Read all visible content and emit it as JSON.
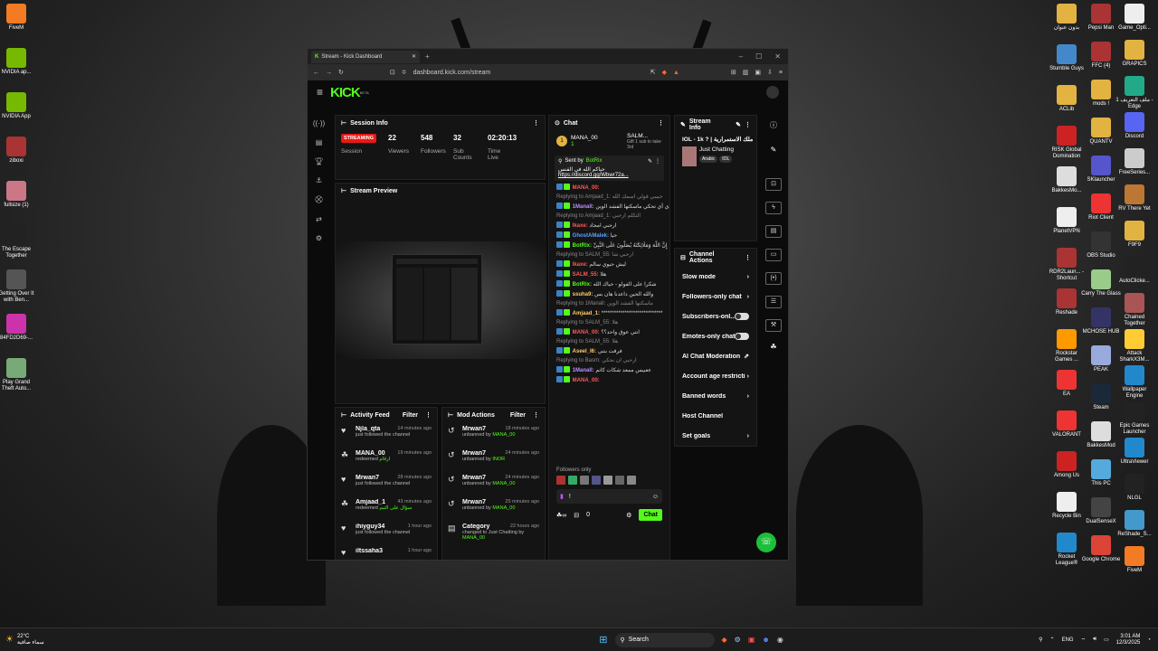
{
  "desktop_left": [
    {
      "label": "FiveM",
      "color": "#f27b23"
    },
    {
      "label": "NVIDIA ap...",
      "color": "#76b900"
    },
    {
      "label": "NVIDIA App",
      "color": "#76b900"
    },
    {
      "label": "ziboxi",
      "color": "#a33"
    },
    {
      "label": "fullsize (1)",
      "color": "#c78"
    },
    {
      "label": "The Escape Together",
      "color": "#222"
    },
    {
      "label": "Getting Over It with Ben...",
      "color": "#555"
    },
    {
      "label": "84FD2D69-...",
      "color": "#c3a"
    },
    {
      "label": "Play Grand Theft Auto...",
      "color": "#7a7"
    }
  ],
  "desktop_right_a": [
    {
      "label": "بدون عنوان",
      "color": "#e3b341"
    },
    {
      "label": "Stumble Guys",
      "color": "#48c"
    },
    {
      "label": "ACLib",
      "color": "#e3b341"
    },
    {
      "label": "RISK Global Domination",
      "color": "#c22"
    },
    {
      "label": "BakkesMo...",
      "color": "#ddd"
    },
    {
      "label": "PlanetVPN",
      "color": "#eee"
    },
    {
      "label": "RDR2Laun... - Shortcut",
      "color": "#a33"
    },
    {
      "label": "Reshade",
      "color": "#a33"
    },
    {
      "label": "Rockstar Games ...",
      "color": "#f90"
    },
    {
      "label": "EA",
      "color": "#e33"
    },
    {
      "label": "VALORANT",
      "color": "#e33"
    },
    {
      "label": "Among Us",
      "color": "#c22"
    },
    {
      "label": "Recycle Bin",
      "color": "#eee"
    },
    {
      "label": "Rocket League®",
      "color": "#28c"
    }
  ],
  "desktop_right_b": [
    {
      "label": "Pepsi Man",
      "color": "#a33"
    },
    {
      "label": "FFC (4)",
      "color": "#a33"
    },
    {
      "label": "mods !",
      "color": "#e3b341"
    },
    {
      "label": "QUANTV",
      "color": "#e3b341"
    },
    {
      "label": "SKlauncher",
      "color": "#55c"
    },
    {
      "label": "Riot Client",
      "color": "#e33"
    },
    {
      "label": "OBS Studio",
      "color": "#333"
    },
    {
      "label": "Carry The Glass",
      "color": "#9c8"
    },
    {
      "label": "MCHOSE HUB",
      "color": "#336"
    },
    {
      "label": "PEAK",
      "color": "#9ad"
    },
    {
      "label": "Steam",
      "color": "#1b2838"
    },
    {
      "label": "BakkesMod",
      "color": "#ddd"
    },
    {
      "label": "This PC",
      "color": "#5ad"
    },
    {
      "label": "DualSenseX",
      "color": "#444"
    },
    {
      "label": "Google Chrome",
      "color": "#db4437"
    }
  ],
  "desktop_right_c": [
    {
      "label": "Game_Opti...",
      "color": "#eee"
    },
    {
      "label": "GRAPICS",
      "color": "#e3b341"
    },
    {
      "label": "ملف التعريف 1 - Edge",
      "color": "#2a8"
    },
    {
      "label": "Discord",
      "color": "#5865f2"
    },
    {
      "label": "FreeSeries...",
      "color": "#ccc"
    },
    {
      "label": "RV There Yet",
      "color": "#b73"
    },
    {
      "label": "F9F9",
      "color": "#e3b341"
    },
    {
      "label": "AutoClicke...",
      "color": "#222"
    },
    {
      "label": "Chained Together",
      "color": "#a55"
    },
    {
      "label": "Attack SharkX3M...",
      "color": "#fc3"
    },
    {
      "label": "Wallpaper Engine",
      "color": "#28c"
    },
    {
      "label": "Epic Games Launcher",
      "color": "#222"
    },
    {
      "label": "UltraViewer",
      "color": "#28c"
    },
    {
      "label": "NLGL",
      "color": "#222"
    },
    {
      "label": "ReShade_S...",
      "color": "#49c"
    },
    {
      "label": "FiveM",
      "color": "#f27b23"
    }
  ],
  "browser": {
    "tab_title": "Stream - Kick Dashboard",
    "url": "dashboard.kick.com/stream"
  },
  "kick": {
    "logo": "KICK",
    "logo_sup": "BETA"
  },
  "session": {
    "title": "Session Info",
    "status": "STREAMING",
    "status_label": "Session",
    "viewers": "22",
    "viewers_label": "Viewers",
    "followers": "548",
    "followers_label": "Followers",
    "subs": "32",
    "subs_label": "Sub Counts",
    "time": "02:20:13",
    "time_label": "Time Live"
  },
  "preview": {
    "title": "Stream Preview"
  },
  "activity": {
    "title": "Activity Feed",
    "filter": "Filter",
    "items": [
      {
        "icon": "♥",
        "name": "Njla_qta",
        "time": "14 minutes ago",
        "desc": "just followed the channel",
        "extra": ""
      },
      {
        "icon": "☘",
        "name": "MANA_00",
        "time": "19 minutes ago",
        "desc": "redeemed",
        "extra": "ارقام"
      },
      {
        "icon": "♥",
        "name": "Mrwan7",
        "time": "28 minutes ago",
        "desc": "just followed the channel",
        "extra": ""
      },
      {
        "icon": "☘",
        "name": "Amjaad_1",
        "time": "43 minutes ago",
        "desc": "redeemed",
        "extra": "سؤال على التيم"
      },
      {
        "icon": "♥",
        "name": "ihiyguy34",
        "time": "1 hour ago",
        "desc": "just followed the channel",
        "extra": ""
      },
      {
        "icon": "♥",
        "name": "iltssaha3",
        "time": "1 hour ago",
        "desc": "",
        "extra": ""
      }
    ]
  },
  "mod": {
    "title": "Mod Actions",
    "filter": "Filter",
    "items": [
      {
        "name": "Mrwan7",
        "time": "18 minutes ago",
        "desc": "unbanned by",
        "who": "MANA_00"
      },
      {
        "name": "Mrwan7",
        "time": "24 minutes ago",
        "desc": "unbanned by",
        "who": "INOR"
      },
      {
        "name": "Mrwan7",
        "time": "24 minutes ago",
        "desc": "unbanned by",
        "who": "MANA_00"
      },
      {
        "name": "Mrwan7",
        "time": "25 minutes ago",
        "desc": "unbanned by",
        "who": "MANA_00"
      },
      {
        "name": "Category",
        "time": "22 hours ago",
        "desc": "changed to Just Chatting by",
        "who": "MANA_00"
      }
    ]
  },
  "chat": {
    "title": "Chat",
    "top_user": "MANA_00",
    "top_count": "1",
    "gift_user": "SALM...",
    "gift_text": "Gift 1 sub to take 3rd",
    "pinned_sent_by": "Sent by",
    "pinned_bot": "BotRix",
    "pinned_text": "حياكم الله في القنس",
    "pinned_link": "https://discord.gg/Wbwr72a...",
    "lines": [
      {
        "reply": "",
        "user": "MANA_00:",
        "ucolor": "#ff5a5a",
        "text": ""
      },
      {
        "reply": "Replying to Amjaad_1: حبيبي قولي اسمك الله",
        "user": "",
        "ucolor": "",
        "text": ""
      },
      {
        "reply": "",
        "user": "1Manall:",
        "ucolor": "#b890ff",
        "text": "لا ذي أي تحكي ماسكتها الفشد الوين"
      },
      {
        "reply": "Replying to Amjaad_1: التكلم ارحبي",
        "user": "",
        "ucolor": "",
        "text": ""
      },
      {
        "reply": "",
        "user": "lkaxe:",
        "ucolor": "#ff5a5a",
        "text": "ارحبي امجاد"
      },
      {
        "reply": "",
        "user": "GhostAMalek:",
        "ucolor": "#5aa0ff",
        "text": "حيا"
      },
      {
        "reply": "",
        "user": "BotRix:",
        "ucolor": "#53fc18",
        "text": "إِنَّ اللَّهَ وَمَلَائِكَتَهُ يُصَلُّونَ عَلَى النَّبِيِّ"
      },
      {
        "reply": "Replying to SALM_55: ارحبي شا",
        "user": "",
        "ucolor": "",
        "text": ""
      },
      {
        "reply": "",
        "user": "lkaxe:",
        "ucolor": "#ff5a5a",
        "text": "ليش حيوي سالم"
      },
      {
        "reply": "",
        "user": "SALM_55:",
        "ucolor": "#ff5a5a",
        "text": "هلا"
      },
      {
        "reply": "",
        "user": "BotRix:",
        "ucolor": "#53fc18",
        "text": "شكرا على الفولو - حياك الله"
      },
      {
        "reply": "",
        "user": "ssuha9:",
        "ucolor": "#ffcc66",
        "text": "والله الحين داعدنا هان بس"
      },
      {
        "reply": "Replying to 1Manall: ماسكتها الفشد الوين",
        "user": "",
        "ucolor": "",
        "text": ""
      },
      {
        "reply": "",
        "user": "Amjaad_1:",
        "ucolor": "#ffcc66",
        "text": "*****************************"
      },
      {
        "reply": "Replying to SALM_55: هلا",
        "user": "",
        "ucolor": "",
        "text": ""
      },
      {
        "reply": "",
        "user": "MANA_00:",
        "ucolor": "#ff5a5a",
        "text": "انتي عوق واحد؟؟"
      },
      {
        "reply": "Replying to SALM_55: هلا",
        "user": "",
        "ucolor": "",
        "text": ""
      },
      {
        "reply": "",
        "user": "Aseel_I6:",
        "ucolor": "#ffcc66",
        "text": "فرقت بنتي"
      },
      {
        "reply": "Replying to Basm: ارحبي ان نحكي",
        "user": "",
        "ucolor": "",
        "text": ""
      },
      {
        "reply": "",
        "user": "1Manall:",
        "ucolor": "#b890ff",
        "text": "ععبيس ممعد شكات كاتم"
      },
      {
        "reply": "",
        "user": "MANA_00:",
        "ucolor": "#ff5a5a",
        "text": ""
      }
    ],
    "followers_only": "Followers only",
    "input_value": "!",
    "counter": "0",
    "send": "Chat"
  },
  "stream_info": {
    "title": "Stream Info",
    "stream_title": "IOL - 1k ? | ملك الاستمرارية",
    "category": "Just Chatting",
    "tags": [
      "Arabic",
      "IOL"
    ]
  },
  "channel_actions": {
    "title": "Channel Actions",
    "items": [
      {
        "label": "Slow mode",
        "control": "chevron"
      },
      {
        "label": "Followers-only chat",
        "control": "chevron"
      },
      {
        "label": "Subscribers-onl...",
        "control": "toggle"
      },
      {
        "label": "Emotes-only chat",
        "control": "toggle"
      },
      {
        "label": "AI Chat Moderation",
        "control": "external"
      },
      {
        "label": "Account age restricti",
        "control": "chevron"
      },
      {
        "label": "Banned words",
        "control": "chevron"
      },
      {
        "label": "Host Channel",
        "control": "none"
      },
      {
        "label": "Set goals",
        "control": "chevron"
      }
    ]
  },
  "taskbar": {
    "weather_temp": "22°C",
    "weather_text": "سماء صافية",
    "search": "Search",
    "lang": "ENG",
    "time": "3:01 AM",
    "date": "12/3/2025"
  }
}
